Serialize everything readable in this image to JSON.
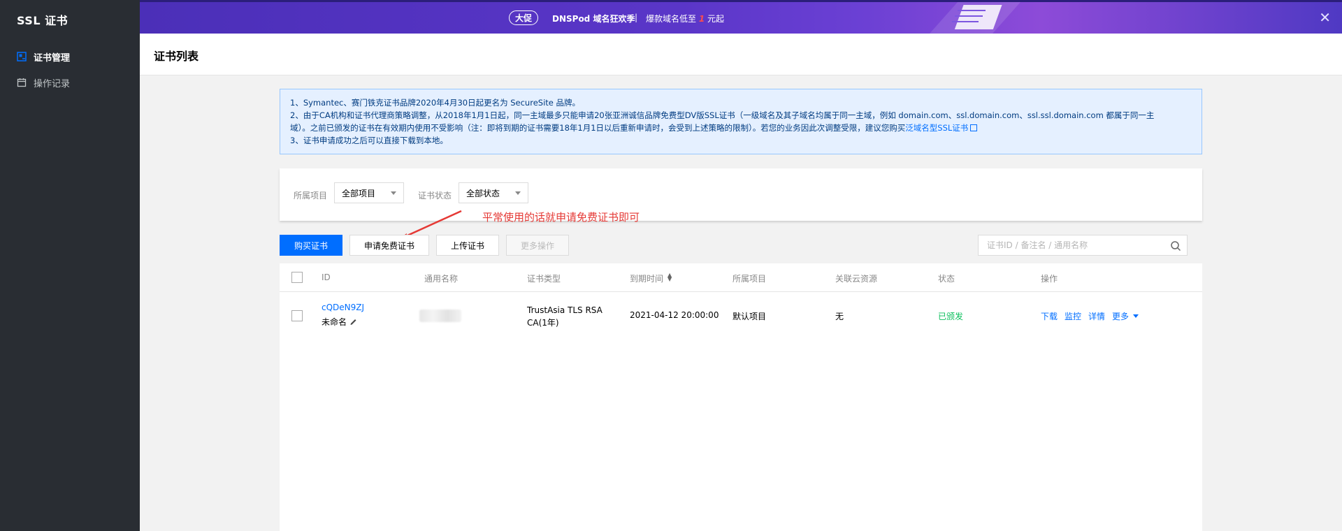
{
  "sidebar": {
    "title": "SSL 证书",
    "items": [
      {
        "label": "证书管理",
        "icon": "certificate-icon",
        "active": true
      },
      {
        "label": "操作记录",
        "icon": "calendar-icon",
        "active": false
      }
    ]
  },
  "banner": {
    "badge": "大促",
    "text1": "DNSPod 域名狂欢季",
    "separator": "|",
    "text2_prefix": "爆款域名低至",
    "text2_number": "1",
    "text2_suffix": "元起",
    "close": "✕"
  },
  "page": {
    "title": "证书列表"
  },
  "notice": {
    "line1": "1、Symantec、赛门铁克证书品牌2020年4月30日起更名为 SecureSite 品牌。",
    "line2": "2、由于CA机构和证书代理商策略调整，从2018年1月1日起，同一主域最多只能申请20张亚洲诚信品牌免费型DV版SSL证书（一级域名及其子域名均属于同一主域，例如 domain.com、ssl.domain.com、ssl.ssl.domain.com 都属于同一主",
    "line3_prefix": "域）。之前已颁发的证书在有效期内使用不受影响（注：即将到期的证书需要18年1月1日以后重新申请时，会受到上述策略的限制）。若您的业务因此次调整受限，建议您购买",
    "line3_link": "泛域名型SSL证书",
    "line4": "3、证书申请成功之后可以直接下载到本地。"
  },
  "filter": {
    "project_label": "所属项目",
    "project_value": "全部项目",
    "status_label": "证书状态",
    "status_value": "全部状态"
  },
  "annotation": "平常使用的话就申请免费证书即可",
  "toolbar": {
    "buy": "购买证书",
    "apply_free": "申请免费证书",
    "upload": "上传证书",
    "more": "更多操作",
    "search_placeholder": "证书ID / 备注名 / 通用名称"
  },
  "table": {
    "headers": [
      "ID",
      "通用名称",
      "证书类型",
      "到期时间",
      "所属项目",
      "关联云资源",
      "状态",
      "操作"
    ],
    "rows": [
      {
        "id": "cQDeN9ZJ",
        "alias": "未命名",
        "type_line1": "TrustAsia TLS RSA",
        "type_line2": "CA(1年)",
        "expiry": "2021-04-12 20:00:00",
        "project": "默认项目",
        "cloud": "无",
        "status": "已颁发",
        "actions": [
          "下载",
          "监控",
          "详情",
          "更多"
        ]
      }
    ]
  },
  "colors": {
    "primary": "#006eff",
    "sidebar_bg": "#292d33",
    "status_issued": "#0abf5b",
    "annotation": "#e53935"
  }
}
